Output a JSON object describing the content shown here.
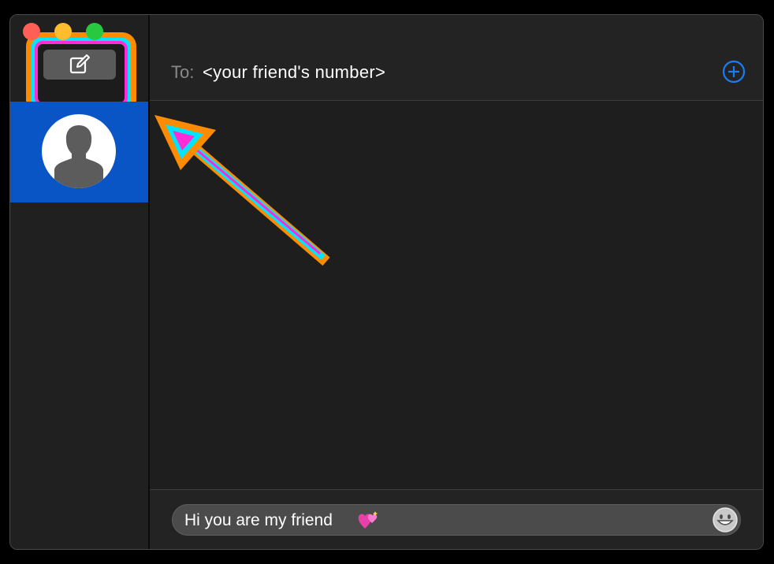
{
  "window": {
    "controls": [
      "close",
      "minimize",
      "zoom"
    ]
  },
  "sidebar": {
    "compose_icon": "compose-icon",
    "conversations": [
      {
        "avatar_icon": "person-silhouette-icon",
        "selected": true
      }
    ]
  },
  "header": {
    "to_label": "To:",
    "to_value": "<your friend's number>",
    "add_icon": "plus-circle-icon"
  },
  "composer": {
    "message_text": "Hi you are my friend",
    "inline_emoji": "sparkling-hearts-icon",
    "emoji_icon": "smiley-icon"
  },
  "annotation": {
    "arrow_colors": [
      "#ff8c00",
      "#00e5ff",
      "#ff2bd6"
    ],
    "highlight_colors": [
      "#ff8c00",
      "#00e5ff",
      "#ff2bd6"
    ]
  },
  "colors": {
    "selection": "#0a55c5",
    "accent": "#1a7cf2"
  }
}
